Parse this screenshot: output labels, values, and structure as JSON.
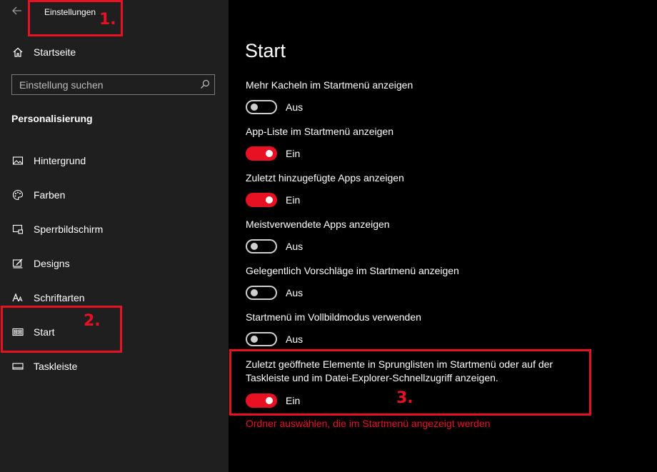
{
  "window": {
    "title": "Einstellungen"
  },
  "sidebar": {
    "home_label": "Startseite",
    "search_placeholder": "Einstellung suchen",
    "section": "Personalisierung",
    "items": [
      {
        "label": "Hintergrund",
        "icon": "image-icon"
      },
      {
        "label": "Farben",
        "icon": "palette-icon"
      },
      {
        "label": "Sperrbildschirm",
        "icon": "lockscreen-icon"
      },
      {
        "label": "Designs",
        "icon": "brush-icon"
      },
      {
        "label": "Schriftarten",
        "icon": "font-icon"
      },
      {
        "label": "Start",
        "icon": "start-menu-icon",
        "selected": true
      },
      {
        "label": "Taskleiste",
        "icon": "taskbar-icon"
      }
    ]
  },
  "main": {
    "title": "Start",
    "settings": [
      {
        "label": "Mehr Kacheln im Startmenü anzeigen",
        "state": "Aus",
        "on": false
      },
      {
        "label": "App-Liste im Startmenü anzeigen",
        "state": "Ein",
        "on": true
      },
      {
        "label": "Zuletzt hinzugefügte Apps anzeigen",
        "state": "Ein",
        "on": true
      },
      {
        "label": "Meistverwendete Apps anzeigen",
        "state": "Aus",
        "on": false
      },
      {
        "label": "Gelegentlich Vorschläge im Startmenü anzeigen",
        "state": "Aus",
        "on": false
      },
      {
        "label": "Startmenü im Vollbildmodus verwenden",
        "state": "Aus",
        "on": false
      },
      {
        "label": "Zuletzt geöffnete Elemente in Sprunglisten im Startmenü oder auf der Taskleiste und im Datei-Explorer-Schnellzugriff anzeigen.",
        "state": "Ein",
        "on": true
      }
    ],
    "link": "Ordner auswählen, die im Startmenü angezeigt werden"
  },
  "annotations": [
    "1.",
    "2.",
    "3."
  ],
  "colors": {
    "accent": "#e81123",
    "sidebar_bg": "#1f1f1f",
    "main_bg": "#000000"
  }
}
